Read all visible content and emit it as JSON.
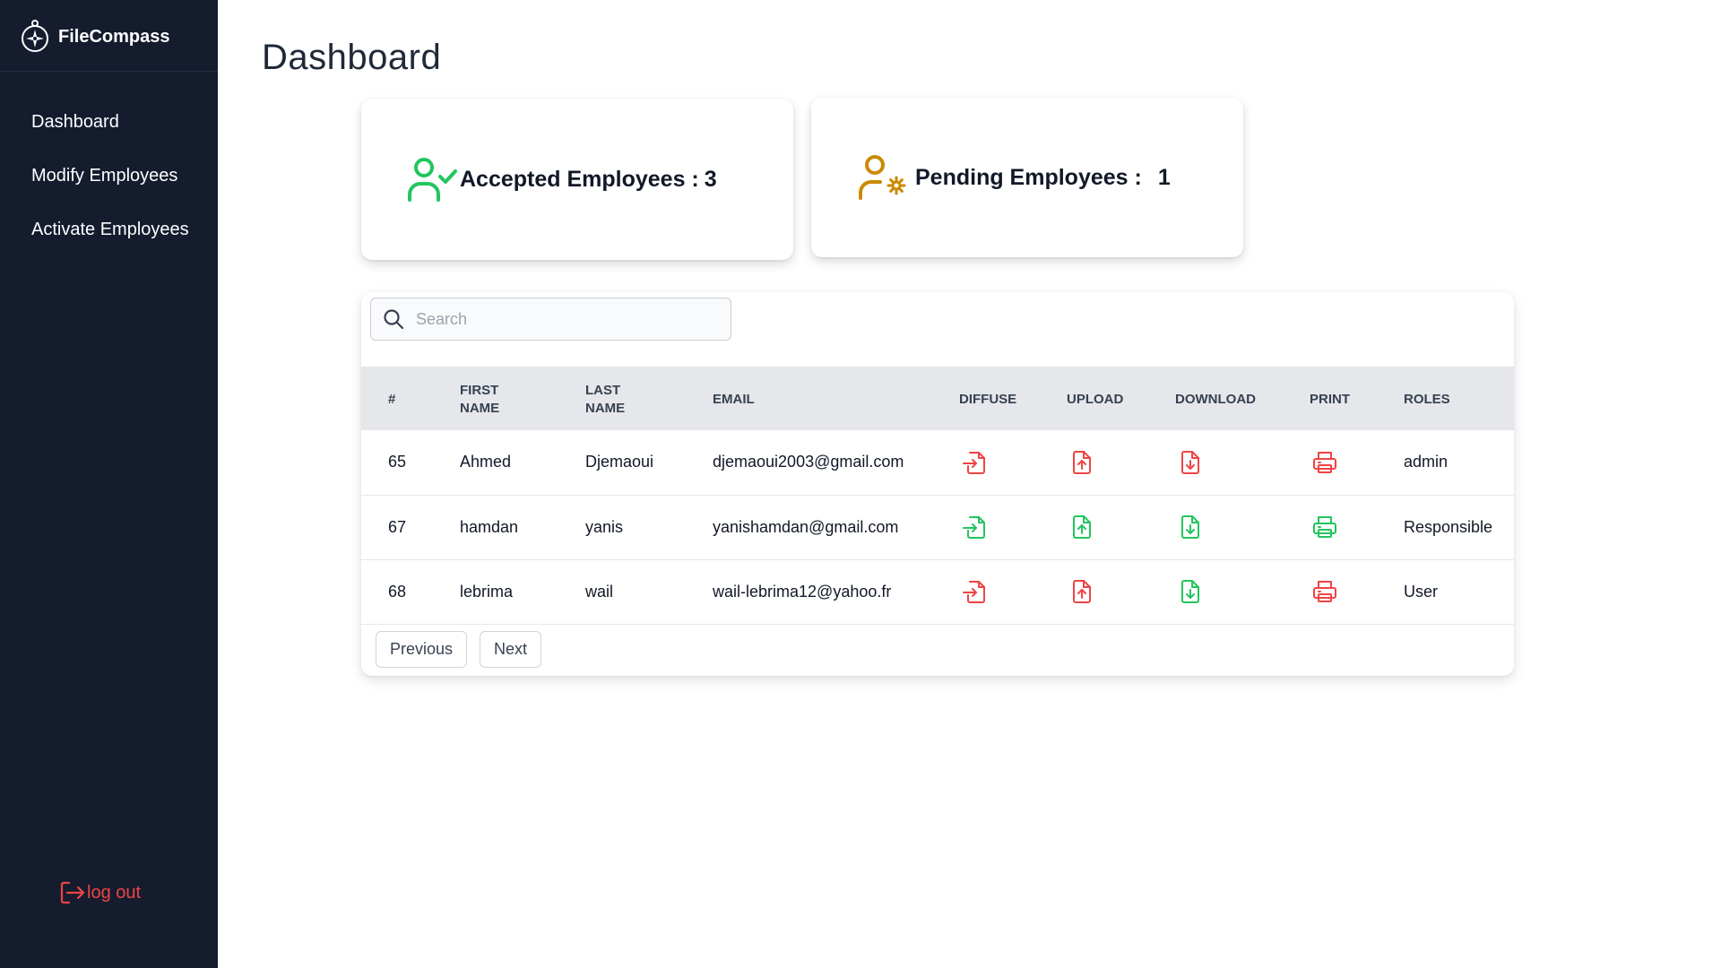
{
  "brand": {
    "name": "FileCompass",
    "icon": "compass-icon"
  },
  "sidebar": {
    "items": [
      {
        "label": "Dashboard"
      },
      {
        "label": "Modify Employees"
      },
      {
        "label": "Activate Employees"
      }
    ],
    "logout_label": "log out"
  },
  "page": {
    "title": "Dashboard"
  },
  "stats": {
    "accepted": {
      "label": "Accepted Employees :",
      "value": "3",
      "color": "#22c55e"
    },
    "pending": {
      "label": "Pending Employees :",
      "value": "1",
      "color": "#ca8a04"
    }
  },
  "search": {
    "placeholder": "Search",
    "value": ""
  },
  "table": {
    "columns": [
      "#",
      "FIRST NAME",
      "LAST NAME",
      "EMAIL",
      "DIFFUSE",
      "UPLOAD",
      "DOWNLOAD",
      "PRINT",
      "ROLES"
    ],
    "rows": [
      {
        "id": "65",
        "first_name": "Ahmed",
        "last_name": "Djemaoui",
        "email": "djemaoui2003@gmail.com",
        "diffuse": "denied",
        "upload": "denied",
        "download": "denied",
        "print": "denied",
        "role": "admin"
      },
      {
        "id": "67",
        "first_name": "hamdan",
        "last_name": "yanis",
        "email": "yanishamdan@gmail.com",
        "diffuse": "allowed",
        "upload": "allowed",
        "download": "allowed",
        "print": "allowed",
        "role": "Responsible"
      },
      {
        "id": "68",
        "first_name": "lebrima",
        "last_name": "wail",
        "email": "wail-lebrima12@yahoo.fr",
        "diffuse": "denied",
        "upload": "denied",
        "download": "allowed",
        "print": "denied",
        "role": "User"
      }
    ]
  },
  "pagination": {
    "previous_label": "Previous",
    "next_label": "Next"
  },
  "colors": {
    "sidebar_bg": "#141c2e",
    "allowed": "#22c55e",
    "denied": "#ef4444",
    "header_bg": "#e5e7eb"
  },
  "icons": {
    "diffuse": "file-import-icon",
    "upload": "file-upload-icon",
    "download": "file-download-icon",
    "print": "printer-icon"
  }
}
